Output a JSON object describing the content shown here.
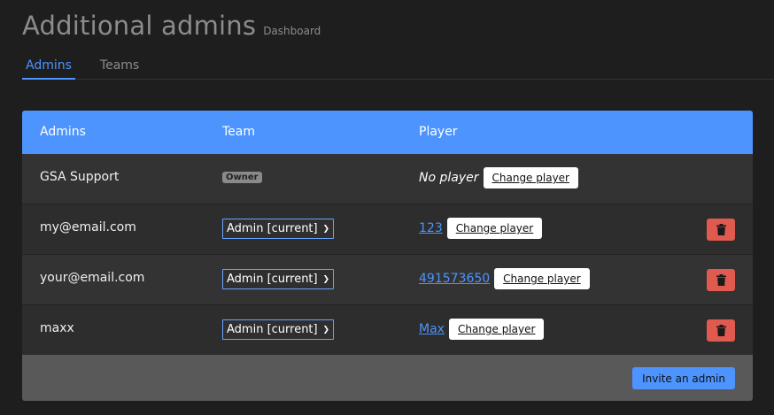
{
  "header": {
    "title": "Additional admins",
    "subtitle": "Dashboard"
  },
  "tabs": [
    {
      "label": "Admins",
      "active": true
    },
    {
      "label": "Teams",
      "active": false
    }
  ],
  "table": {
    "columns": [
      "Admins",
      "Team",
      "Player"
    ],
    "rows": [
      {
        "admin": "GSA Support",
        "team_badge": "Owner",
        "player_text": "No player",
        "change_label": "Change player"
      },
      {
        "admin": "my@email.com",
        "team": "Admin [current]",
        "player_link": "123",
        "change_label": "Change player"
      },
      {
        "admin": "your@email.com",
        "team": "Admin [current]",
        "player_link": "491573650",
        "change_label": "Change player"
      },
      {
        "admin": "maxx",
        "team": "Admin [current]",
        "player_link": "Max",
        "change_label": "Change player"
      }
    ]
  },
  "footer": {
    "invite_label": "Invite an admin"
  },
  "colors": {
    "accent": "#4d94ff",
    "danger": "#e05a4f",
    "background": "#1e1e1e"
  },
  "icons": {
    "delete": "trash-icon",
    "select": "chevron-down-icon"
  }
}
